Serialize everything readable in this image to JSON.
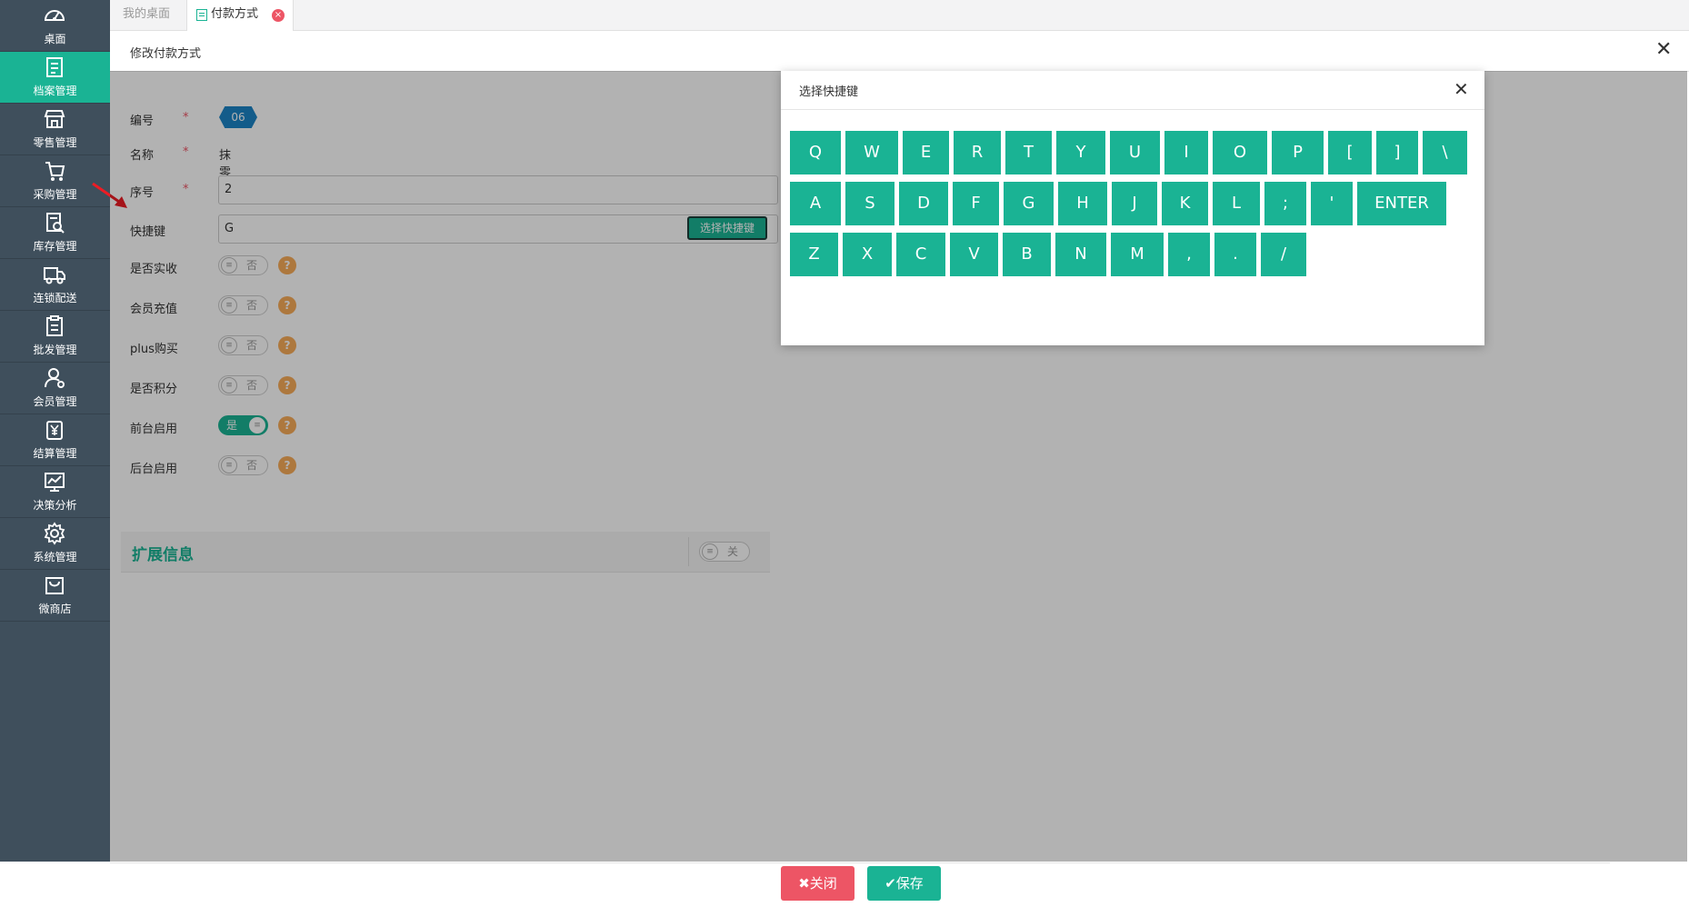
{
  "sidebar": {
    "items": [
      {
        "label": "桌面",
        "icon": "dashboard-icon"
      },
      {
        "label": "档案管理",
        "icon": "archive-icon",
        "active": true
      },
      {
        "label": "零售管理",
        "icon": "store-icon"
      },
      {
        "label": "采购管理",
        "icon": "cart-icon"
      },
      {
        "label": "库存管理",
        "icon": "inventory-icon"
      },
      {
        "label": "连锁配送",
        "icon": "truck-icon"
      },
      {
        "label": "批发管理",
        "icon": "wholesale-icon"
      },
      {
        "label": "会员管理",
        "icon": "member-icon"
      },
      {
        "label": "结算管理",
        "icon": "settlement-icon"
      },
      {
        "label": "决策分析",
        "icon": "chart-icon"
      },
      {
        "label": "系统管理",
        "icon": "gear-icon"
      },
      {
        "label": "微商店",
        "icon": "shop-bag-icon"
      }
    ]
  },
  "tabs": {
    "desk": "我的桌面",
    "payment": "付款方式",
    "close_glyph": "×"
  },
  "modal": {
    "title": "修改付款方式",
    "close_glyph": "✕"
  },
  "form": {
    "required_mark": "*",
    "help_glyph": "?",
    "code": {
      "label": "编号",
      "value": "06"
    },
    "name": {
      "label": "名称",
      "value": "抹零"
    },
    "order": {
      "label": "序号",
      "value": "2"
    },
    "shortcut": {
      "label": "快捷键",
      "value": "G",
      "button": "选择快捷键"
    },
    "toggles": [
      {
        "label": "是否实收",
        "state": "否",
        "on": false
      },
      {
        "label": "会员充值",
        "state": "否",
        "on": false
      },
      {
        "label": "plus购买",
        "state": "否",
        "on": false
      },
      {
        "label": "是否积分",
        "state": "否",
        "on": false
      },
      {
        "label": "前台启用",
        "state": "是",
        "on": true
      },
      {
        "label": "后台启用",
        "state": "否",
        "on": false
      }
    ],
    "knob_glyph": "≡"
  },
  "extension": {
    "title": "扩展信息",
    "toggle_state": "关"
  },
  "footer": {
    "close_label": "✖关闭",
    "save_label": "✔保存"
  },
  "keyboard": {
    "title": "选择快捷键",
    "close_glyph": "✕",
    "rows": [
      [
        "Q",
        "W",
        "E",
        "R",
        "T",
        "Y",
        "U",
        "I",
        "O",
        "P",
        "[",
        "]",
        "\\"
      ],
      [
        "A",
        "S",
        "D",
        "F",
        "G",
        "H",
        "J",
        "K",
        "L",
        ";",
        "'",
        "ENTER"
      ],
      [
        "Z",
        "X",
        "C",
        "V",
        "B",
        "N",
        "M",
        ",",
        ".",
        "/"
      ]
    ]
  },
  "colors": {
    "sidebar_bg": "#3f4f5c",
    "accent": "#1ab394",
    "danger": "#ed5565",
    "help": "#f8ac59",
    "badge": "#1c84c6",
    "arrow": "#ed1c24"
  }
}
